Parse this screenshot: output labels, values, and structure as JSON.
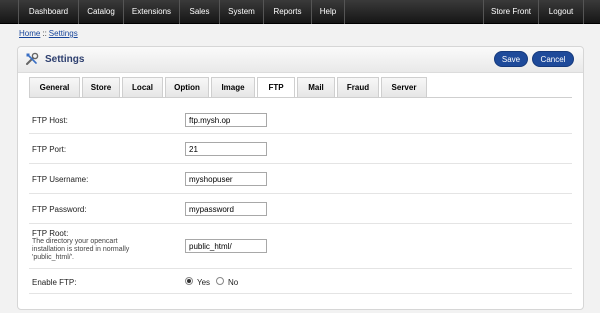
{
  "topbar": {
    "menu": [
      "Dashboard",
      "Catalog",
      "Extensions",
      "Sales",
      "System",
      "Reports",
      "Help"
    ],
    "right": [
      "Store Front",
      "Logout"
    ]
  },
  "breadcrumb": {
    "home": "Home",
    "separator": "::",
    "current": "Settings"
  },
  "panel": {
    "title": "Settings",
    "icon": "tools-icon",
    "save_label": "Save",
    "cancel_label": "Cancel",
    "accent_color": "#1e4a9a"
  },
  "tabs": [
    "General",
    "Store",
    "Local",
    "Option",
    "Image",
    "FTP",
    "Mail",
    "Fraud",
    "Server"
  ],
  "active_tab": "FTP",
  "form": {
    "ftp_host": {
      "label": "FTP Host:",
      "value": "ftp.mysh.op"
    },
    "ftp_port": {
      "label": "FTP Port:",
      "value": "21"
    },
    "ftp_username": {
      "label": "FTP Username:",
      "value": "myshopuser"
    },
    "ftp_password": {
      "label": "FTP Password:",
      "value": "mypassword"
    },
    "ftp_root": {
      "label": "FTP Root:",
      "help": "The directory your opencart installation is stored in normally 'public_html/'.",
      "value": "public_html/"
    },
    "enable_ftp": {
      "label": "Enable FTP:",
      "yes": "Yes",
      "no": "No",
      "selected": "Yes"
    }
  }
}
